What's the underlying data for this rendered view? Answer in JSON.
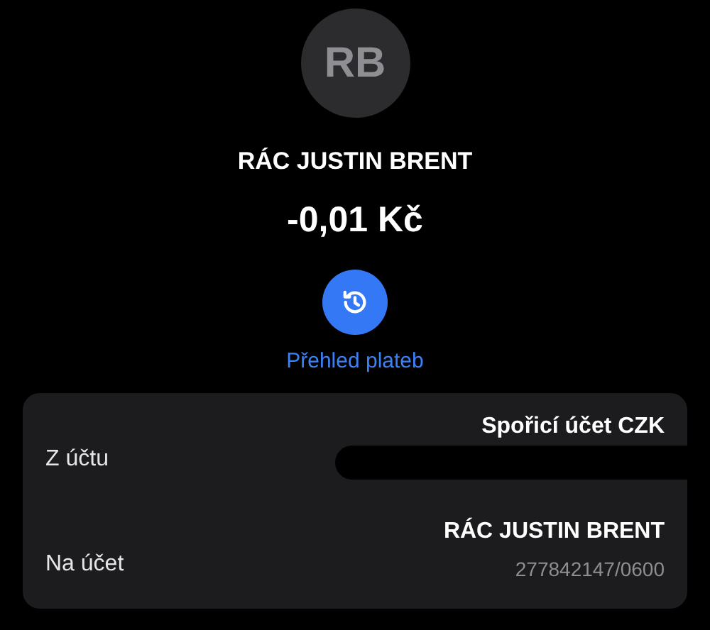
{
  "avatar": {
    "initials": "RB"
  },
  "payee": "RÁC JUSTIN BRENT",
  "amount": "-0,01 Kč",
  "history_link": "Přehled plateb",
  "details": [
    {
      "label": "Z účtu",
      "value": "Spořicí účet CZK",
      "redacted": true
    },
    {
      "label": "Na účet",
      "value": "RÁC JUSTIN BRENT",
      "sub": "277842147/0600",
      "redacted": false
    }
  ]
}
